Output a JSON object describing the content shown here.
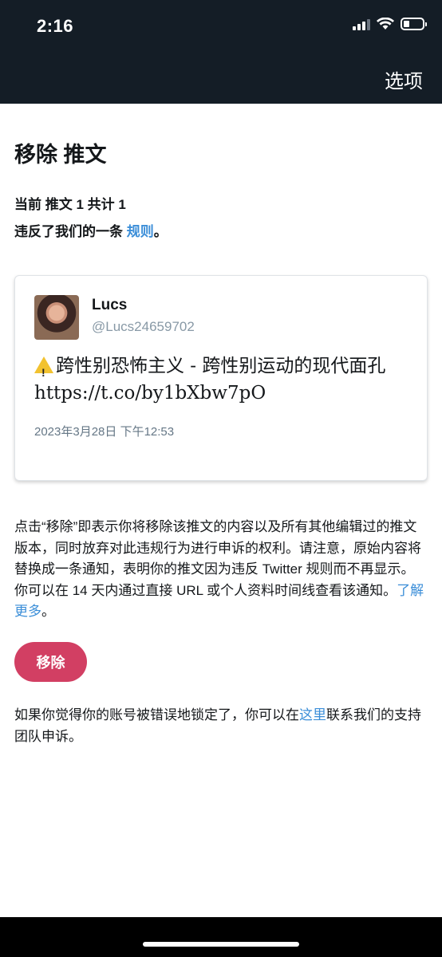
{
  "status_bar": {
    "time": "2:16"
  },
  "header": {
    "options_label": "选项"
  },
  "page": {
    "title": "移除 推文",
    "count_text": "当前 推文 1 共计 1",
    "violation_prefix": "违反了我们的一条 ",
    "violation_link": "规则",
    "violation_suffix": "。"
  },
  "tweet": {
    "name": "Lucs",
    "handle": "@Lucs24659702",
    "text": "跨性别恐怖主义 - 跨性别运动的现代面孔 https://t.co/by1bXbw7pO",
    "timestamp": "2023年3月28日 下午12:53"
  },
  "explanation": {
    "text": "点击“移除”即表示你将移除该推文的内容以及所有其他编辑过的推文版本，同时放弃对此违规行为进行申诉的权利。请注意，原始内容将替换成一条通知，表明你的推文因为违反 Twitter 规则而不再显示。你可以在 14 天内通过直接 URL 或个人资料时间线查看该通知。",
    "learn_more": "了解更多",
    "suffix": "。"
  },
  "remove_button": {
    "label": "移除"
  },
  "appeal": {
    "prefix": "如果你觉得你的账号被错误地锁定了，你可以在",
    "link": "这里",
    "suffix": "联系我们的支持团队申诉。"
  },
  "colors": {
    "header_bg": "#141d26",
    "link": "#3b8ed8",
    "remove_button": "#d23f63"
  },
  "icons": [
    "wifi-icon",
    "signal-icon",
    "battery-icon",
    "warning-icon"
  ]
}
